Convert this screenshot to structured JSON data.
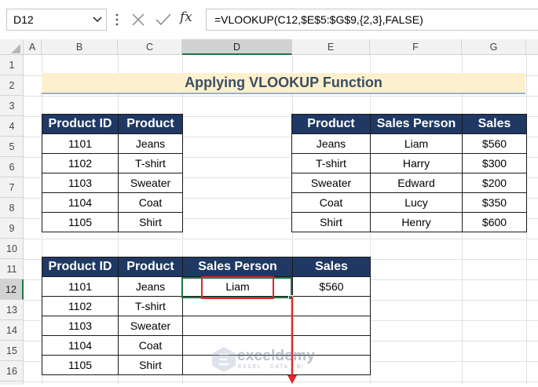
{
  "formula_bar": {
    "name_box": "D12",
    "formula": "=VLOOKUP(C12,$E$5:$G$9,{2,3},FALSE)"
  },
  "columns": [
    "A",
    "B",
    "C",
    "D",
    "E",
    "F",
    "G"
  ],
  "rows": [
    "1",
    "2",
    "3",
    "4",
    "5",
    "6",
    "7",
    "8",
    "9",
    "10",
    "11",
    "12",
    "13",
    "14",
    "15",
    "16"
  ],
  "selected_column": "D",
  "selected_row": "12",
  "title": "Applying VLOOKUP Function",
  "table1": {
    "headers": [
      "Product ID",
      "Product"
    ],
    "rows": [
      [
        "1101",
        "Jeans"
      ],
      [
        "1102",
        "T-shirt"
      ],
      [
        "1103",
        "Sweater"
      ],
      [
        "1104",
        "Coat"
      ],
      [
        "1105",
        "Shirt"
      ]
    ]
  },
  "table2": {
    "headers": [
      "Product",
      "Sales Person",
      "Sales"
    ],
    "rows": [
      [
        "Jeans",
        "Liam",
        "$560"
      ],
      [
        "T-shirt",
        "Harry",
        "$300"
      ],
      [
        "Sweater",
        "Edward",
        "$200"
      ],
      [
        "Coat",
        "Lucy",
        "$350"
      ],
      [
        "Shirt",
        "Henry",
        "$600"
      ]
    ]
  },
  "table3": {
    "headers": [
      "Product ID",
      "Product",
      "Sales Person",
      "Sales"
    ],
    "rows": [
      [
        "1101",
        "Jeans",
        "Liam",
        "$560"
      ],
      [
        "1102",
        "T-shirt",
        "",
        ""
      ],
      [
        "1103",
        "Sweater",
        "",
        ""
      ],
      [
        "1104",
        "Coat",
        "",
        ""
      ],
      [
        "1105",
        "Shirt",
        "",
        ""
      ]
    ]
  },
  "watermark": {
    "name": "exceldemy",
    "tagline": "EXCEL · DATA · BI"
  },
  "colors": {
    "header_fill": "#1f3864",
    "title_fill": "#fdf0cc",
    "highlight_red": "#e3262b",
    "selection_green": "#217346"
  },
  "icons": [
    "chevron-down-icon",
    "more-options-icon",
    "cancel-x-icon",
    "enter-check-icon",
    "function-fx-icon",
    "down-arrow-icon",
    "exceldemy-logo-icon"
  ]
}
